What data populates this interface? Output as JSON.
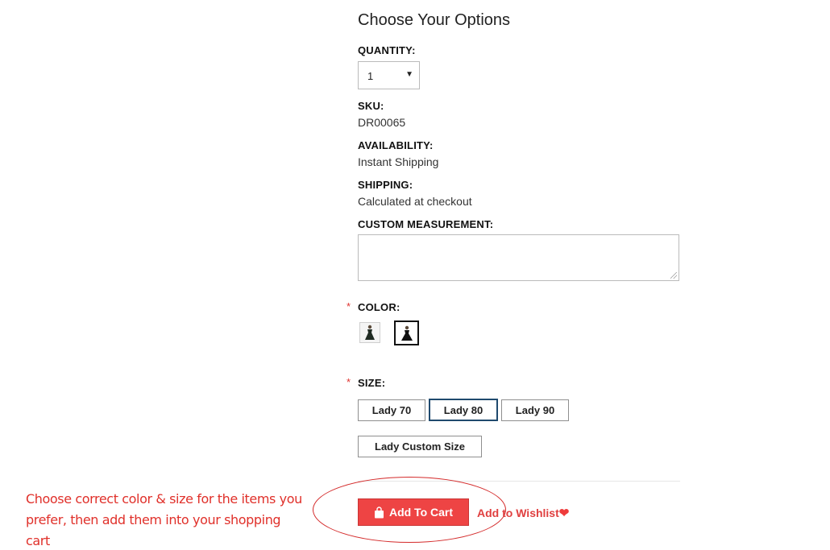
{
  "options": {
    "title": "Choose Your Options",
    "quantity_label": "QUANTITY:",
    "quantity_value": "1",
    "sku_label": "SKU:",
    "sku_value": "DR00065",
    "availability_label": "AVAILABILITY:",
    "availability_value": "Instant Shipping",
    "shipping_label": "SHIPPING:",
    "shipping_value": "Calculated at checkout",
    "custom_label": "CUSTOM MEASUREMENT:",
    "custom_value": "",
    "required_mark": "*",
    "color_label": "COLOR:",
    "color_swatches": [
      {
        "icon": "dress-swatch-icon",
        "selected": false
      },
      {
        "icon": "dress-swatch-icon",
        "selected": true
      }
    ],
    "size_label": "SIZE:",
    "sizes": [
      {
        "label": "Lady 70",
        "selected": false
      },
      {
        "label": "Lady 80",
        "selected": true
      },
      {
        "label": "Lady 90",
        "selected": false
      },
      {
        "label": "Lady Custom Size",
        "selected": false
      }
    ]
  },
  "actions": {
    "cart_icon": "shopping-bag-icon",
    "add_to_cart": "Add To Cart",
    "add_to_wishlist": "Add to Wishlist",
    "wishlist_icon": "heart-icon"
  },
  "annotation": {
    "line1": "Choose correct color & size for the items you",
    "line2": "prefer, then add them into your shopping cart"
  },
  "colors": {
    "accent": "#ee4444",
    "annotation": "#e0302a",
    "selected_border": "#1f4a6e"
  }
}
